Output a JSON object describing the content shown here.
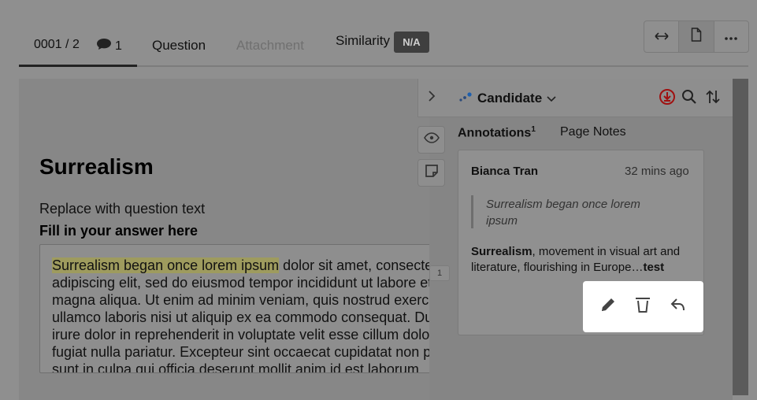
{
  "tabs": {
    "page_current": "0001",
    "page_sep": "/",
    "page_total": "2",
    "comment_count": "1",
    "question": "Question",
    "attachment": "Attachment",
    "similarity": "Similarity",
    "similarity_badge": "N/A"
  },
  "toolbar": {
    "icons": [
      "expand-horizontal-icon",
      "document-icon",
      "more-icon"
    ]
  },
  "document": {
    "title": "Surrealism",
    "question_text": "Replace with question text",
    "answer_label": "Fill in your answer here",
    "answer_highlight": "Surrealism began once lorem ipsum",
    "answer_rest": " dolor sit amet, consectetur adipiscing elit, sed do eiusmod tempor incididunt ut labore et dolore magna aliqua. Ut enim ad minim veniam, quis nostrud exercitation ullamco laboris nisi ut aliquip ex ea commodo consequat. Duis aute irure dolor in reprehenderit in voluptate velit esse cillum dolore eu fugiat nulla pariatur. Excepteur sint occaecat cupidatat non proident, sunt in culpa qui officia deserunt mollit anim id est laborum.",
    "line_marker": "1"
  },
  "sidebar": {
    "candidate_label": "Candidate",
    "tab_annotations": "Annotations",
    "annotations_count": "1",
    "tab_page_notes": "Page Notes",
    "accent_red": "#a01010"
  },
  "annotation": {
    "author": "Bianca Tran",
    "time": "32 mins ago",
    "quote": "Surrealism began once lorem ipsum",
    "body_bold": "Surrealism",
    "body_text": ", movement in visual art and literature, flourishing in Europe…",
    "body_tail": "test"
  }
}
